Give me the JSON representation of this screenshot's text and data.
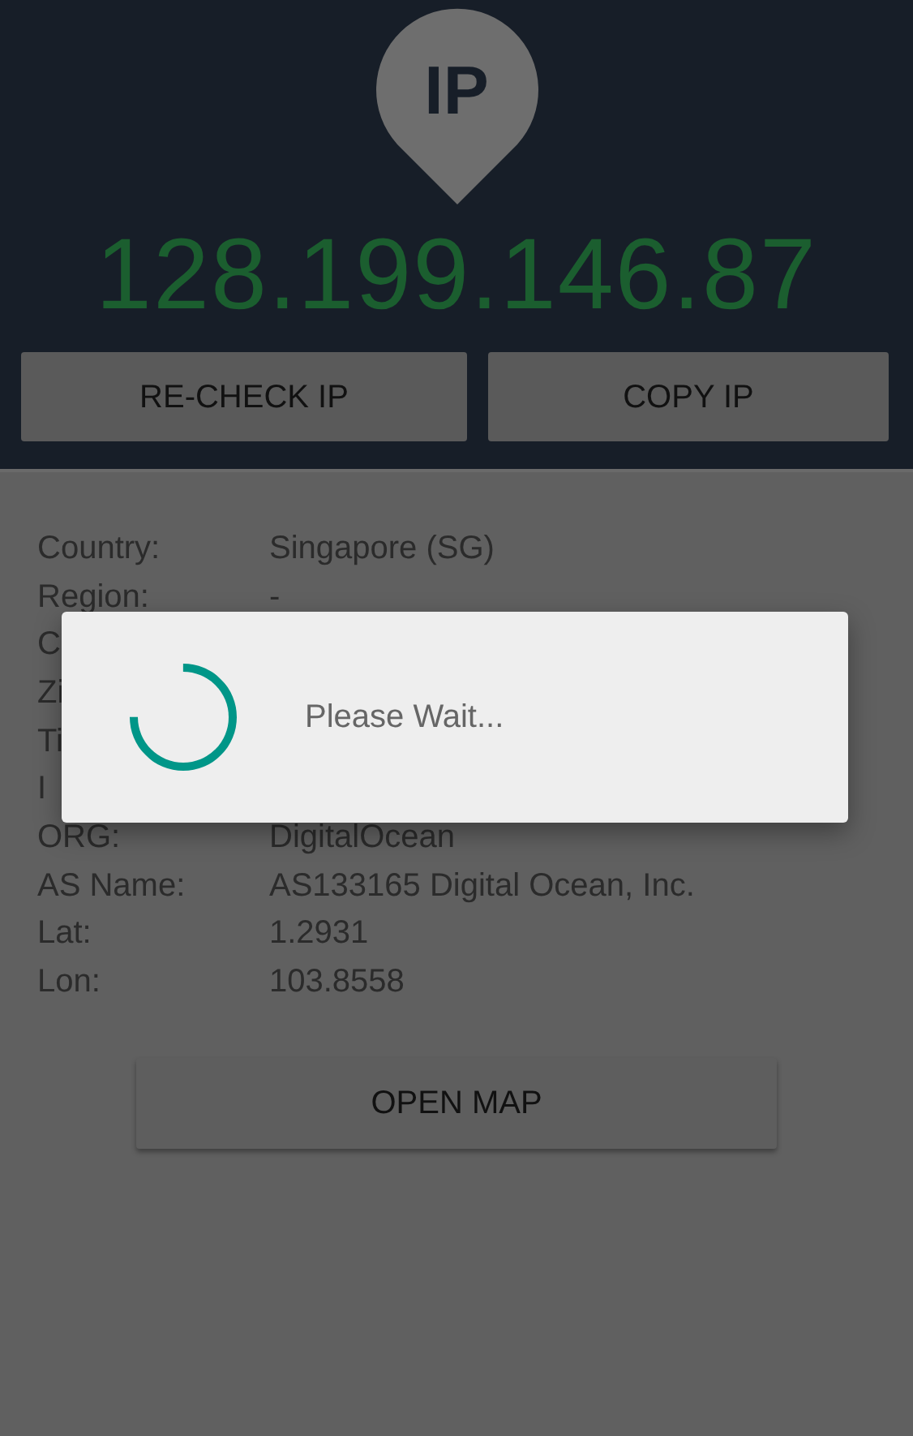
{
  "header": {
    "badge": "IP",
    "ip_address": "128.199.146.87",
    "buttons": [
      "RE-CHECK IP",
      "COPY IP"
    ]
  },
  "details": [
    {
      "label": "Country:",
      "value": "Singapore (SG)"
    },
    {
      "label": "Region:",
      "value": "-"
    },
    {
      "label": "C"
    },
    {
      "label": "Zi"
    },
    {
      "label": "Ti"
    },
    {
      "label": "I"
    },
    {
      "label": "ORG:",
      "value": "DigitalOcean"
    },
    {
      "label": "AS Name:",
      "value": "AS133165 Digital Ocean, Inc."
    },
    {
      "label": "Lat:",
      "value": "1.2931"
    },
    {
      "label": "Lon:",
      "value": "103.8558"
    }
  ],
  "open_map_button": "OPEN MAP",
  "dialog": {
    "message": "Please Wait..."
  }
}
